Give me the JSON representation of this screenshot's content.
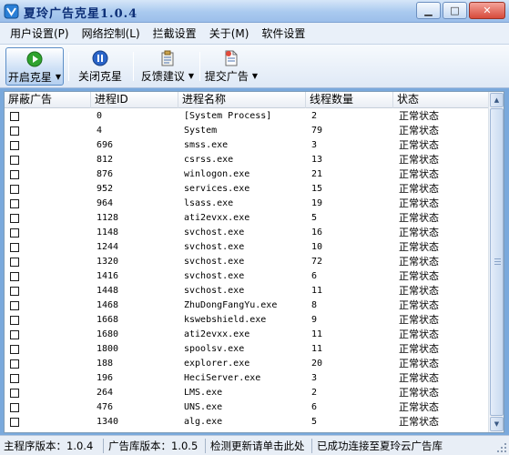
{
  "window": {
    "title": "夏玲广告克星1.0.4"
  },
  "menu": [
    {
      "label": "用户设置(P)"
    },
    {
      "label": "网络控制(L)"
    },
    {
      "label": "拦截设置"
    },
    {
      "label": "关于(M)"
    },
    {
      "label": "软件设置"
    }
  ],
  "toolbar": {
    "start": {
      "label": "开启克星",
      "icon": "play-icon"
    },
    "stop": {
      "label": "关闭克星",
      "icon": "pause-icon"
    },
    "feedback": {
      "label": "反馈建议",
      "icon": "clipboard-icon"
    },
    "submit": {
      "label": "提交广告",
      "icon": "document-add-icon"
    }
  },
  "table": {
    "headers": [
      "屏蔽广告",
      "进程ID",
      "进程名称",
      "线程数量",
      "状态"
    ],
    "rows": [
      {
        "pid": "0",
        "name": "[System Process]",
        "threads": "2",
        "status": "正常状态"
      },
      {
        "pid": "4",
        "name": "System",
        "threads": "79",
        "status": "正常状态"
      },
      {
        "pid": "696",
        "name": "smss.exe",
        "threads": "3",
        "status": "正常状态"
      },
      {
        "pid": "812",
        "name": "csrss.exe",
        "threads": "13",
        "status": "正常状态"
      },
      {
        "pid": "876",
        "name": "winlogon.exe",
        "threads": "21",
        "status": "正常状态"
      },
      {
        "pid": "952",
        "name": "services.exe",
        "threads": "15",
        "status": "正常状态"
      },
      {
        "pid": "964",
        "name": "lsass.exe",
        "threads": "19",
        "status": "正常状态"
      },
      {
        "pid": "1128",
        "name": "ati2evxx.exe",
        "threads": "5",
        "status": "正常状态"
      },
      {
        "pid": "1148",
        "name": "svchost.exe",
        "threads": "16",
        "status": "正常状态"
      },
      {
        "pid": "1244",
        "name": "svchost.exe",
        "threads": "10",
        "status": "正常状态"
      },
      {
        "pid": "1320",
        "name": "svchost.exe",
        "threads": "72",
        "status": "正常状态"
      },
      {
        "pid": "1416",
        "name": "svchost.exe",
        "threads": "6",
        "status": "正常状态"
      },
      {
        "pid": "1448",
        "name": "svchost.exe",
        "threads": "11",
        "status": "正常状态"
      },
      {
        "pid": "1468",
        "name": "ZhuDongFangYu.exe",
        "threads": "8",
        "status": "正常状态"
      },
      {
        "pid": "1668",
        "name": "kswebshield.exe",
        "threads": "9",
        "status": "正常状态"
      },
      {
        "pid": "1680",
        "name": "ati2evxx.exe",
        "threads": "11",
        "status": "正常状态"
      },
      {
        "pid": "1800",
        "name": "spoolsv.exe",
        "threads": "11",
        "status": "正常状态"
      },
      {
        "pid": "188",
        "name": "explorer.exe",
        "threads": "20",
        "status": "正常状态"
      },
      {
        "pid": "196",
        "name": "HeciServer.exe",
        "threads": "3",
        "status": "正常状态"
      },
      {
        "pid": "264",
        "name": "LMS.exe",
        "threads": "2",
        "status": "正常状态"
      },
      {
        "pid": "476",
        "name": "UNS.exe",
        "threads": "6",
        "status": "正常状态"
      },
      {
        "pid": "1340",
        "name": "alg.exe",
        "threads": "5",
        "status": "正常状态"
      }
    ]
  },
  "status": {
    "main_version": "主程序版本：1.0.4",
    "ad_version": "广告库版本：1.0.5",
    "update": "检测更新请单击此处",
    "connection": "已成功连接至夏玲云广告库"
  },
  "colors": {
    "accent": "#0d2f77",
    "titlebar": "#a9c9ef",
    "start_icon": "#2fa32f",
    "stop_icon": "#2a64c8"
  }
}
